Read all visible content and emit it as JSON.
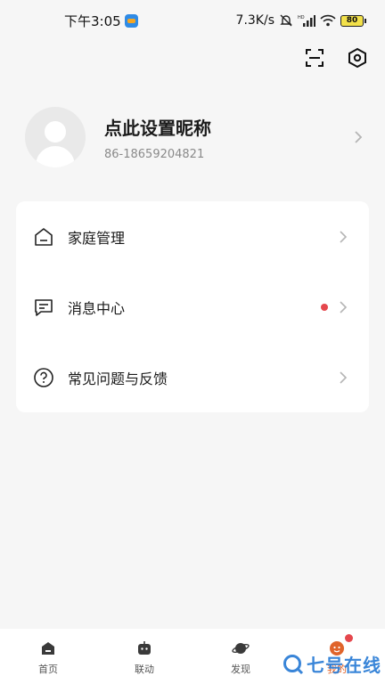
{
  "status_bar": {
    "time": "下午3:05",
    "net_speed": "7.3K/s",
    "battery": "80"
  },
  "icons": {
    "scan": "scan-icon",
    "settings": "settings-icon"
  },
  "profile": {
    "nickname": "点此设置昵称",
    "phone": "86-18659204821"
  },
  "menu": [
    {
      "label": "家庭管理",
      "icon": "home-icon",
      "has_dot": false
    },
    {
      "label": "消息中心",
      "icon": "message-icon",
      "has_dot": true
    },
    {
      "label": "常见问题与反馈",
      "icon": "help-icon",
      "has_dot": false
    }
  ],
  "tabs": [
    {
      "label": "首页",
      "icon": "home-tab-icon",
      "active": false
    },
    {
      "label": "联动",
      "icon": "linkage-tab-icon",
      "active": false
    },
    {
      "label": "发现",
      "icon": "discover-tab-icon",
      "active": false
    },
    {
      "label": "我的",
      "icon": "profile-tab-icon",
      "active": true
    }
  ],
  "watermark": "七号在线",
  "colors": {
    "accent": "#e0642b",
    "badge_red": "#e5474d",
    "background": "#f6f6f6",
    "watermark": "#2f7fd6"
  }
}
